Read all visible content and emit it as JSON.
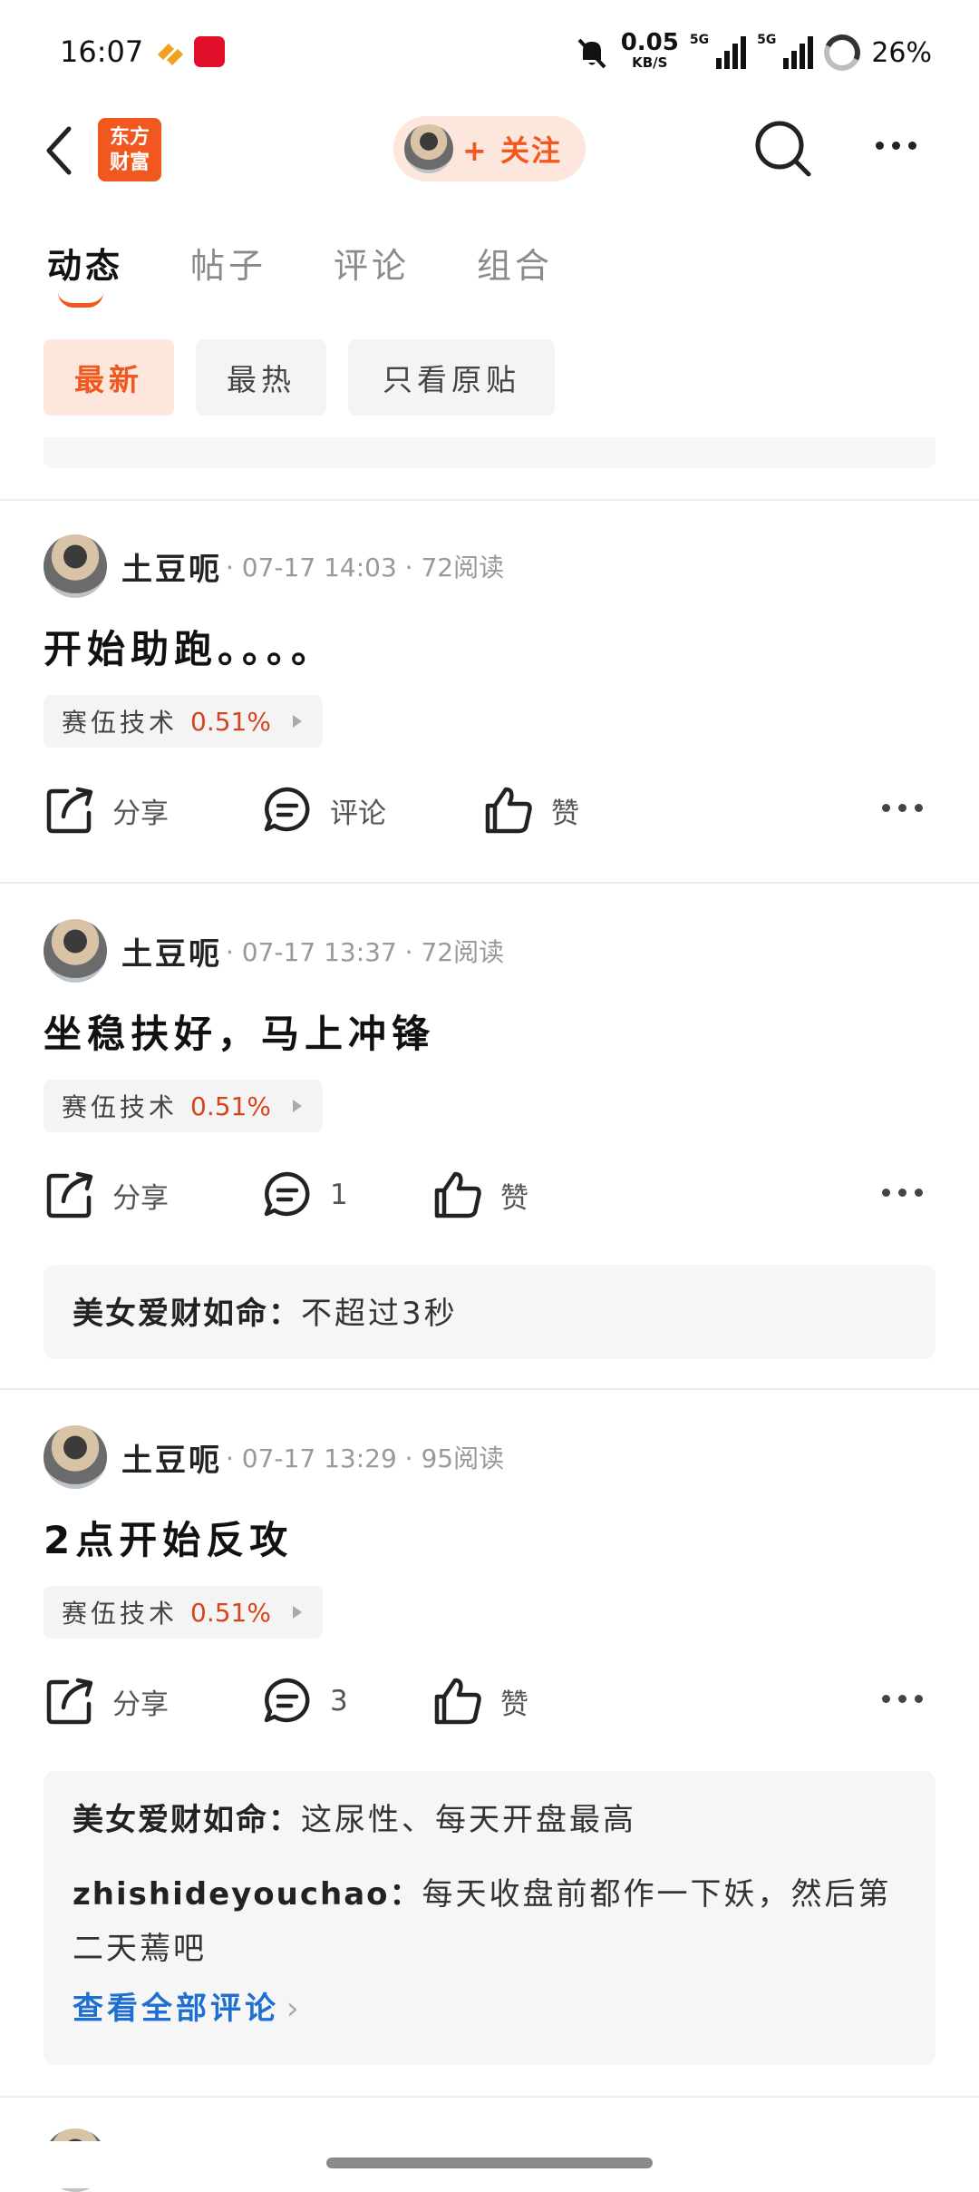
{
  "status_bar": {
    "time": "16:07",
    "net_speed": "0.05",
    "net_unit": "KB/S",
    "sig1_label": "5G",
    "sig2_label": "5G",
    "battery": "26%"
  },
  "header": {
    "logo_line1": "东方",
    "logo_line2": "财富",
    "follow_label": "+ 关注"
  },
  "tabs": [
    "动态",
    "帖子",
    "评论",
    "组合"
  ],
  "filters": [
    "最新",
    "最热",
    "只看原贴"
  ],
  "posts": [
    {
      "user": "土豆呃",
      "info": "· 07-17 14:03 · 72阅读",
      "content": "开始助跑。。。。",
      "stock_name": "赛伍技术",
      "stock_pct": "0.51%",
      "share": "分享",
      "comment": "评论",
      "like": "赞"
    },
    {
      "user": "土豆呃",
      "info": "· 07-17 13:37 · 72阅读",
      "content": "坐稳扶好，马上冲锋",
      "stock_name": "赛伍技术",
      "stock_pct": "0.51%",
      "share": "分享",
      "comment": "1",
      "like": "赞",
      "comments": [
        {
          "user": "美女爱财如命：",
          "text": "不超过3秒"
        }
      ]
    },
    {
      "user": "土豆呃",
      "info": "· 07-17 13:29 · 95阅读",
      "content": "2点开始反攻",
      "stock_name": "赛伍技术",
      "stock_pct": "0.51%",
      "share": "分享",
      "comment": "3",
      "like": "赞",
      "comments": [
        {
          "user": "美女爱财如命：",
          "text": "这尿性、每天开盘最高"
        },
        {
          "user": "zhishideyouchao：",
          "text": "每天收盘前都作一下妖，然后第二天蔫吧"
        }
      ],
      "view_all": "查看全部评论"
    }
  ],
  "colors": {
    "accent": "#f0581f",
    "link": "#1f6fd1",
    "pct": "#d6441d"
  }
}
